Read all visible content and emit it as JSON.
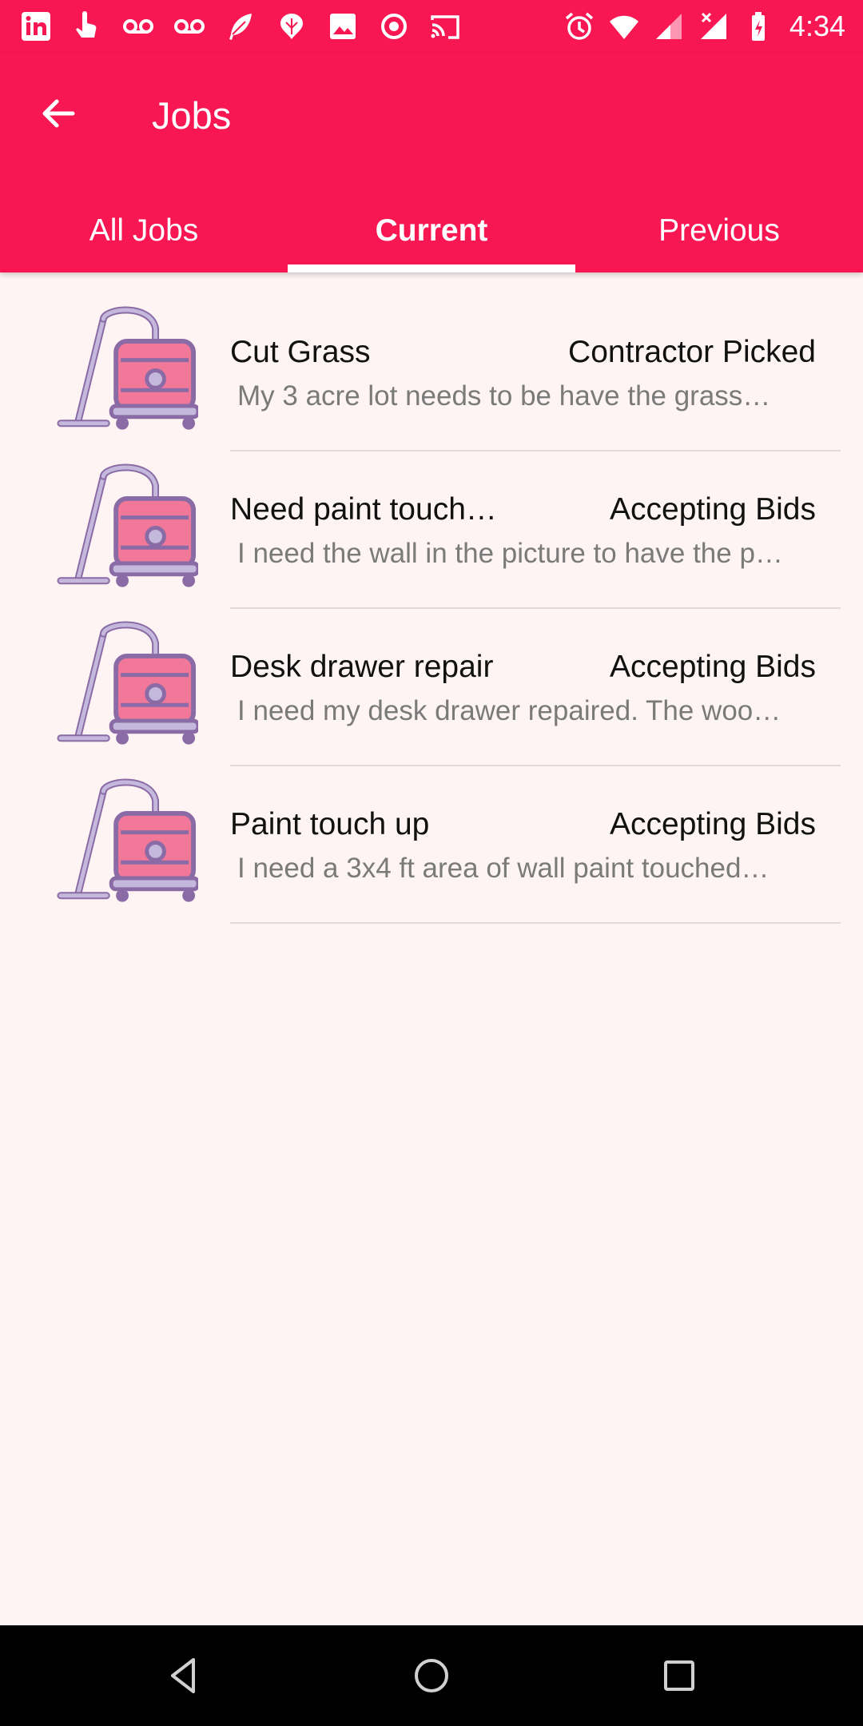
{
  "status_bar": {
    "time": "4:34",
    "left_icons": [
      "linkedin-icon",
      "touch-icon",
      "voicemail-icon",
      "voicemail-icon",
      "feather-icon",
      "flower-icon",
      "image-icon",
      "record-icon",
      "cast-icon"
    ],
    "right_icons": [
      "alarm-icon",
      "wifi-icon",
      "signal-icon",
      "signal-no-service-icon",
      "battery-charging-icon"
    ]
  },
  "app_bar": {
    "title": "Jobs",
    "back_icon": "arrow-back-icon"
  },
  "tabs": [
    {
      "label": "All Jobs",
      "active": false
    },
    {
      "label": "Current",
      "active": true
    },
    {
      "label": "Previous",
      "active": false
    }
  ],
  "jobs": [
    {
      "title": "Cut Grass",
      "status": "Contractor Picked",
      "description": "My 3 acre lot needs to be have the grass…",
      "icon": "vacuum-icon"
    },
    {
      "title": "Need paint touch…",
      "status": "Accepting Bids",
      "description": "I need the wall in the picture to have the p…",
      "icon": "vacuum-icon"
    },
    {
      "title": "Desk drawer repair",
      "status": "Accepting Bids",
      "description": "I need my desk drawer repaired. The woo…",
      "icon": "vacuum-icon"
    },
    {
      "title": "Paint touch up",
      "status": "Accepting Bids",
      "description": "I need a 3x4 ft area of wall paint touched…",
      "icon": "vacuum-icon"
    }
  ],
  "colors": {
    "primary": "#f81752",
    "background": "#fff4f4",
    "icon_pink": "#f2789a",
    "icon_purple": "#8a6ba5",
    "icon_lavender": "#c4b8dc"
  },
  "nav_bar": {
    "buttons": [
      "back-triangle-icon",
      "home-circle-icon",
      "recents-square-icon"
    ]
  }
}
